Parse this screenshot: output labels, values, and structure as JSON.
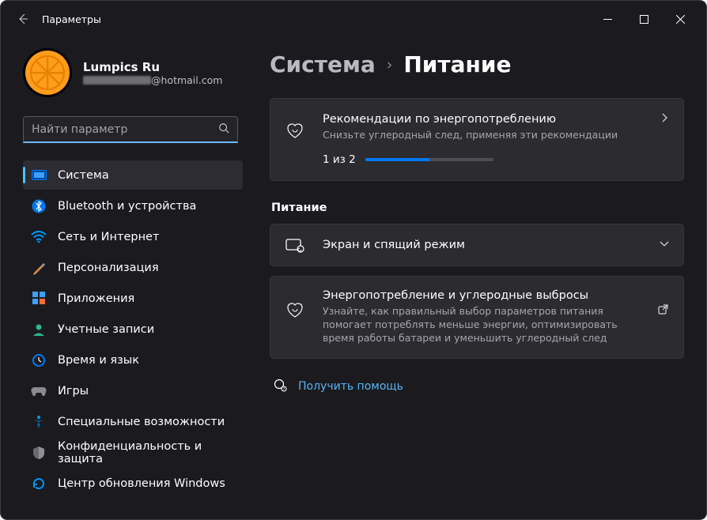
{
  "window": {
    "title": "Параметры"
  },
  "user": {
    "name": "Lumpics Ru",
    "email_suffix": "@hotmail.com"
  },
  "search": {
    "placeholder": "Найти параметр"
  },
  "nav": [
    {
      "id": "system",
      "label": "Система",
      "active": true
    },
    {
      "id": "bluetooth",
      "label": "Bluetooth и устройства"
    },
    {
      "id": "network",
      "label": "Сеть и Интернет"
    },
    {
      "id": "personalization",
      "label": "Персонализация"
    },
    {
      "id": "apps",
      "label": "Приложения"
    },
    {
      "id": "accounts",
      "label": "Учетные записи"
    },
    {
      "id": "time",
      "label": "Время и язык"
    },
    {
      "id": "gaming",
      "label": "Игры"
    },
    {
      "id": "accessibility",
      "label": "Специальные возможности"
    },
    {
      "id": "privacy",
      "label": "Конфиденциальность и защита"
    },
    {
      "id": "update",
      "label": "Центр обновления Windows"
    }
  ],
  "breadcrumb": {
    "parent": "Система",
    "current": "Питание"
  },
  "cards": {
    "recommend": {
      "title": "Рекомендации по энергопотреблению",
      "sub": "Снизьте углеродный след, применяя эти рекомендации",
      "progress_label": "1 из 2",
      "progress_pct": 50
    },
    "section_heading": "Питание",
    "screen": {
      "title": "Экран и спящий режим"
    },
    "energy": {
      "title": "Энергопотребление и углеродные выбросы",
      "sub": "Узнайте, как правильный выбор параметров питания помогает потреблять меньше энергии, оптимизировать время работы батареи и уменьшить углеродный след"
    }
  },
  "help": {
    "label": "Получить помощь"
  }
}
